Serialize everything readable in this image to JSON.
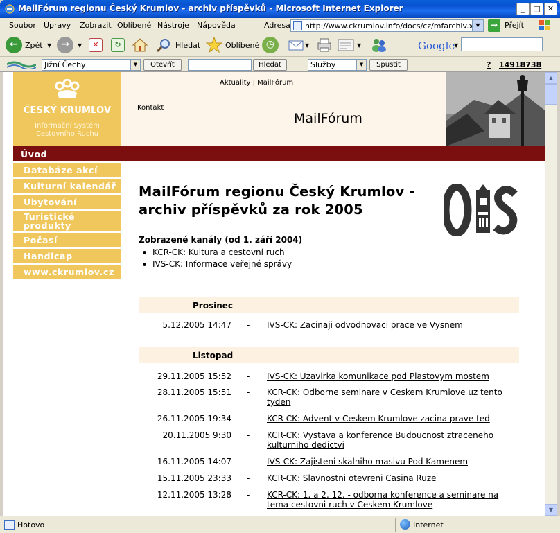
{
  "window": {
    "title": "MailFórum regionu Český Krumlov - archiv příspěvků - Microsoft Internet Explorer"
  },
  "menu": {
    "items": [
      "Soubor",
      "Úpravy",
      "Zobrazit",
      "Oblíbené",
      "Nástroje",
      "Nápověda"
    ],
    "address_label": "Adresa",
    "address": "http://www.ckrumlov.info/docs/cz/mfarchiv.xml",
    "go_label": "Přejít"
  },
  "toolbar": {
    "back_label": "Zpět",
    "search_label": "Hledat",
    "favorites_label": "Oblíbené",
    "google_label": "Google"
  },
  "linksbar": {
    "region": "Jižní Čechy",
    "open_label": "Otevřít",
    "search_button": "Hledat",
    "services": "Služby",
    "run_label": "Spustit",
    "help": "?",
    "counter": "14918738"
  },
  "site": {
    "logo_title": "ČESKÝ KRUMLOV",
    "logo_sub1": "Informační Systém",
    "logo_sub2": "Cestovního Ruchu",
    "top_nav": "Aktuality | MailFórum",
    "contact": "Kontakt",
    "page_heading": "MailFórum"
  },
  "nav": [
    {
      "label": "Úvod",
      "active": true
    },
    {
      "label": "Databáze akcí"
    },
    {
      "label": "Kulturní kalendář"
    },
    {
      "label": "Ubytování"
    },
    {
      "label": "Turistické produkty"
    },
    {
      "label": "Počasí"
    },
    {
      "label": "Handicap"
    },
    {
      "label": "www.ckrumlov.cz"
    }
  ],
  "main": {
    "title": "MailFórum regionu Český Krumlov - archiv příspěvků za rok 2005",
    "channels_title": "Zobrazené kanály (od 1. září 2004)",
    "channels": [
      "KCR-CK: Kultura a cestovní ruch",
      "IVS-CK: Informace veřejné správy"
    ],
    "dash": "-",
    "months": [
      {
        "name": "Prosinec",
        "posts": [
          {
            "date": "5.12.2005 14:47",
            "title": "IVS-CK: Zacinaji odvodnovaci prace ve Vysnem"
          }
        ]
      },
      {
        "name": "Listopad",
        "posts": [
          {
            "date": "29.11.2005 15:52",
            "title": "IVS-CK: Uzavirka komunikace pod Plastovym mostem"
          },
          {
            "date": "28.11.2005 15:51",
            "title": "KCR-CK: Odborne seminare v Ceskem Krumlove uz tento tyden"
          },
          {
            "date": "26.11.2005 19:34",
            "title": "KCR-CK: Advent v Ceskem Krumlove zacina prave ted"
          },
          {
            "date": "20.11.2005 9:30",
            "title": "KCR-CK: Vystava a konference Budoucnost ztraceneho kulturniho dedictvi"
          },
          {
            "date": "16.11.2005 14:07",
            "title": "IVS-CK: Zajisteni skalniho masivu Pod Kamenem"
          },
          {
            "date": "15.11.2005 23:33",
            "title": "KCR-CK: Slavnostni otevreni Casina Ruze"
          },
          {
            "date": "12.11.2005 13:28",
            "title": "KCR-CK: 1. a 2. 12. - odborna konference a seminare na tema cestovni ruch v Ceskem Krumlove"
          }
        ]
      }
    ]
  },
  "status": {
    "text": "Hotovo",
    "zone": "Internet"
  },
  "colors": {
    "nav_yellow": "#f0c75d",
    "dark_red": "#7b0e0e",
    "band_cream": "#fdf1e2"
  }
}
